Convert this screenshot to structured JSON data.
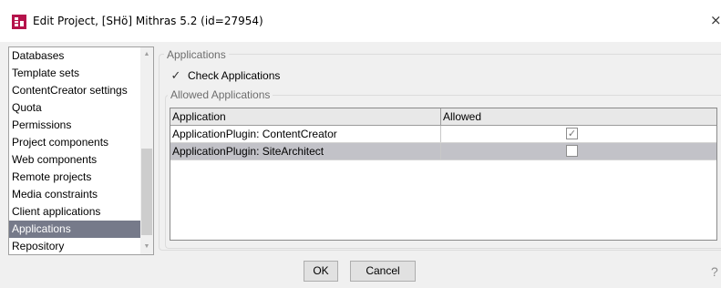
{
  "window": {
    "title": "Edit Project, [SHö] Mithras 5.2 (id=27954)",
    "close_glyph": "×",
    "icon": "firstspirit-app-icon",
    "icon_color": "#b5134b"
  },
  "sidebar": {
    "items": [
      {
        "label": "Databases"
      },
      {
        "label": "Template sets"
      },
      {
        "label": "ContentCreator settings"
      },
      {
        "label": "Quota"
      },
      {
        "label": "Permissions"
      },
      {
        "label": "Project components"
      },
      {
        "label": "Web components"
      },
      {
        "label": "Remote projects"
      },
      {
        "label": "Media constraints"
      },
      {
        "label": "Client applications"
      },
      {
        "label": "Applications",
        "selected": true
      },
      {
        "label": "Repository"
      }
    ],
    "selected_color": "#767a8a"
  },
  "applications_group": {
    "legend": "Applications",
    "check_applications": {
      "label": "Check Applications",
      "checked": true,
      "mark": "✓"
    }
  },
  "allowed_group": {
    "legend": "Allowed Applications",
    "table": {
      "columns": [
        "Application",
        "Allowed"
      ],
      "rows": [
        {
          "application": "ApplicationPlugin: ContentCreator",
          "allowed": true,
          "mark": "✓"
        },
        {
          "application": "ApplicationPlugin: SiteArchitect",
          "allowed": false,
          "mark": ""
        }
      ]
    }
  },
  "footer": {
    "ok_label": "OK",
    "cancel_label": "Cancel",
    "help_glyph": "?"
  }
}
